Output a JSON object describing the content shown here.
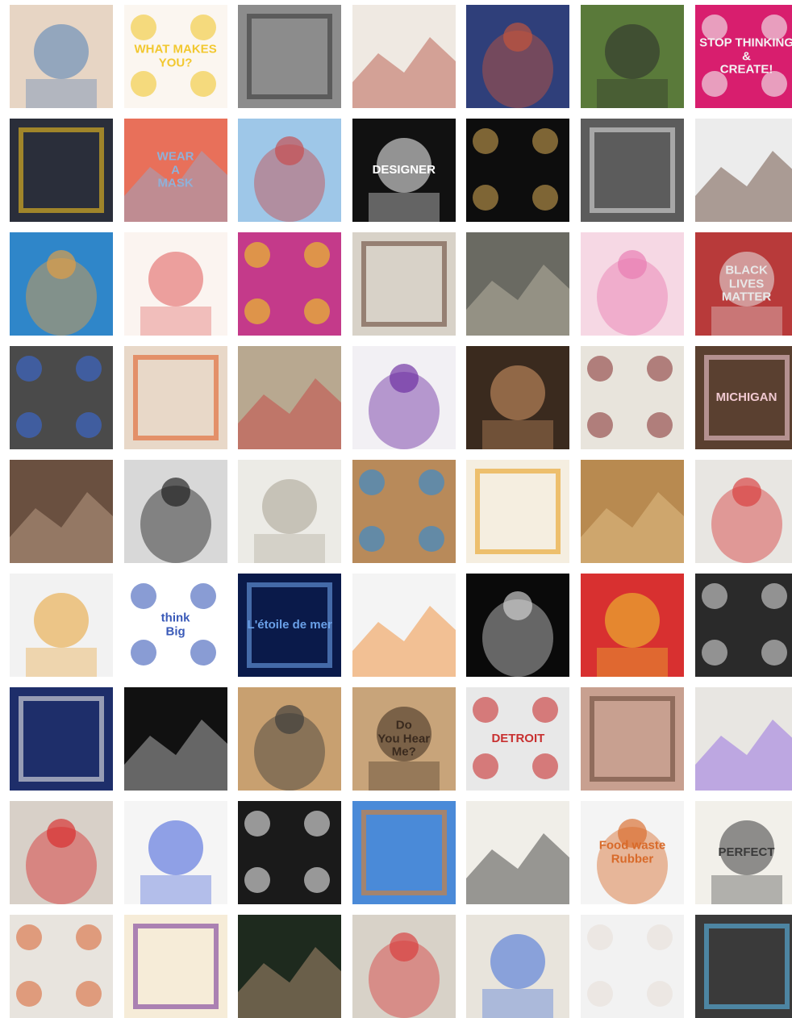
{
  "gallery": {
    "tiles": [
      {
        "name": "tile-portrait-blue-shirt",
        "bg": "#e7d5c4",
        "accent": "#4f7fb8",
        "text": ""
      },
      {
        "name": "tile-what-makes-you",
        "bg": "#fbf6f0",
        "accent": "#f2c830",
        "text": "WHAT MAKES\nYOU?"
      },
      {
        "name": "tile-elderly-woman-drawing",
        "bg": "#8c8c8c",
        "accent": "#3a3a3a",
        "text": ""
      },
      {
        "name": "tile-sketch-two-faces",
        "bg": "#efe9e2",
        "accent": "#b24a3a",
        "text": ""
      },
      {
        "name": "tile-painted-portrait-blue",
        "bg": "#2f3f7a",
        "accent": "#c9563a",
        "text": ""
      },
      {
        "name": "tile-woman-in-garden",
        "bg": "#5a7a3a",
        "accent": "#2b2b2b",
        "text": ""
      },
      {
        "name": "tile-stop-thinking-create",
        "bg": "#d81e6e",
        "accent": "#f3f3f3",
        "text": "STOP THINKING\n&\nCREATE!"
      },
      {
        "name": "tile-superman-portrait",
        "bg": "#2a2e3a",
        "accent": "#f0c020",
        "text": ""
      },
      {
        "name": "tile-wear-a-mask",
        "bg": "#e8705a",
        "accent": "#8fb0d8",
        "text": "WEAR\nA\nMASK"
      },
      {
        "name": "tile-jumping-figures",
        "bg": "#9ec7e8",
        "accent": "#c84a4a",
        "text": ""
      },
      {
        "name": "tile-designer-pattern",
        "bg": "#111111",
        "accent": "#ffffff",
        "text": "DESIGNER"
      },
      {
        "name": "tile-cone-and-bust",
        "bg": "#0d0d0d",
        "accent": "#c9a050",
        "text": ""
      },
      {
        "name": "tile-graphite-drawing",
        "bg": "#5c5c5c",
        "accent": "#d8d8d8",
        "text": ""
      },
      {
        "name": "tile-rock-sculpture",
        "bg": "#ececec",
        "accent": "#5a3a2a",
        "text": ""
      },
      {
        "name": "tile-swimming-pool",
        "bg": "#2f86c9",
        "accent": "#e8a040",
        "text": ""
      },
      {
        "name": "tile-red-dots",
        "bg": "#fbf4f0",
        "accent": "#e05a5a",
        "text": ""
      },
      {
        "name": "tile-colorful-costumes",
        "bg": "#c43a8a",
        "accent": "#f0d020",
        "text": ""
      },
      {
        "name": "tile-painted-man-portrait",
        "bg": "#d8d2c8",
        "accent": "#6a4a3a",
        "text": ""
      },
      {
        "name": "tile-studio-floor-work",
        "bg": "#6a6a62",
        "accent": "#c8c0b0",
        "text": ""
      },
      {
        "name": "tile-pink-shirts-illustration",
        "bg": "#f6d8e4",
        "accent": "#e87ab0",
        "text": ""
      },
      {
        "name": "tile-house-signs",
        "bg": "#b83a3a",
        "accent": "#e8e8e8",
        "text": "BLACK\nLIVES\nMATTER"
      },
      {
        "name": "tile-woman-lightning-shirt",
        "bg": "#4a4a4a",
        "accent": "#3a6ad8",
        "text": ""
      },
      {
        "name": "tile-colorful-studio",
        "bg": "#e8d8c8",
        "accent": "#e0602a",
        "text": ""
      },
      {
        "name": "tile-artist-at-table",
        "bg": "#b8a890",
        "accent": "#c83a3a",
        "text": ""
      },
      {
        "name": "tile-purple-suit",
        "bg": "#f2f0f4",
        "accent": "#6a2aa0",
        "text": ""
      },
      {
        "name": "tile-selfie-peace-sign",
        "bg": "#3a2a1e",
        "accent": "#d89a6a",
        "text": ""
      },
      {
        "name": "tile-studio-critique",
        "bg": "#e8e4dc",
        "accent": "#8a3a3a",
        "text": ""
      },
      {
        "name": "tile-michigan-shirt",
        "bg": "#5a4030",
        "accent": "#f0c8d0",
        "text": "MICHIGAN"
      },
      {
        "name": "tile-alley-buildings",
        "bg": "#6a5040",
        "accent": "#c8a890",
        "text": ""
      },
      {
        "name": "tile-ink-cityscape",
        "bg": "#d8d8d8",
        "accent": "#1a1a1a",
        "text": ""
      },
      {
        "name": "tile-printer-room",
        "bg": "#ecebe6",
        "accent": "#a8a090",
        "text": ""
      },
      {
        "name": "tile-painted-circles",
        "bg": "#b88a5a",
        "accent": "#2a8ad8",
        "text": ""
      },
      {
        "name": "tile-anime-illustration",
        "bg": "#f5eee0",
        "accent": "#e8a020",
        "text": ""
      },
      {
        "name": "tile-textured-surface",
        "bg": "#b88a50",
        "accent": "#e8c890",
        "text": ""
      },
      {
        "name": "tile-paper-pile",
        "bg": "#e8e6e2",
        "accent": "#d83a3a",
        "text": ""
      },
      {
        "name": "tile-hotdog-illustration",
        "bg": "#f2f2f2",
        "accent": "#e8a030",
        "text": ""
      },
      {
        "name": "tile-think-big",
        "bg": "#ffffff",
        "accent": "#3a5ab8",
        "text": "think\nBig"
      },
      {
        "name": "tile-stage-performance",
        "bg": "#0a1a4a",
        "accent": "#6aa0e8",
        "text": "L'étoile de mer"
      },
      {
        "name": "tile-orange-jacket",
        "bg": "#f4f4f4",
        "accent": "#f08020",
        "text": ""
      },
      {
        "name": "tile-cinema-screen",
        "bg": "#0a0a0a",
        "accent": "#d8d8d8",
        "text": ""
      },
      {
        "name": "tile-red-floral-collage",
        "bg": "#d83030",
        "accent": "#f0d030",
        "text": ""
      },
      {
        "name": "tile-bw-smiling-man",
        "bg": "#2a2a2a",
        "accent": "#d8d8d8",
        "text": ""
      },
      {
        "name": "tile-blue-textiles",
        "bg": "#1e2e6a",
        "accent": "#e8e8e8",
        "text": ""
      },
      {
        "name": "tile-film-strips",
        "bg": "#111111",
        "accent": "#cfcfcf",
        "text": ""
      },
      {
        "name": "tile-museum-gallery",
        "bg": "#c8a070",
        "accent": "#3a3a3a",
        "text": ""
      },
      {
        "name": "tile-do-you-hear-me",
        "bg": "#c8a47a",
        "accent": "#3a2a1e",
        "text": "Do\nYou Hear\nMe?"
      },
      {
        "name": "tile-detroit-guide",
        "bg": "#e8e8e8",
        "accent": "#c83030",
        "text": "DETROIT"
      },
      {
        "name": "tile-double-selfie",
        "bg": "#c8a090",
        "accent": "#6a4a3a",
        "text": ""
      },
      {
        "name": "tile-purple-sign",
        "bg": "#e8e6e2",
        "accent": "#8a5ae0",
        "text": ""
      },
      {
        "name": "tile-red-jacket",
        "bg": "#d8d0c8",
        "accent": "#d82a2a",
        "text": ""
      },
      {
        "name": "tile-candy-wrappers",
        "bg": "#f5f5f5",
        "accent": "#3a5ad8",
        "text": ""
      },
      {
        "name": "tile-white-octopus",
        "bg": "#1a1a1a",
        "accent": "#ececec",
        "text": ""
      },
      {
        "name": "tile-autumn-trees",
        "bg": "#4a8ad8",
        "accent": "#e0802a",
        "text": ""
      },
      {
        "name": "tile-botanical-sketches",
        "bg": "#f0eee8",
        "accent": "#2a2a2a",
        "text": ""
      },
      {
        "name": "tile-food-waste-rubber",
        "bg": "#f4f4f4",
        "accent": "#d86a2a",
        "text": "Food waste Rubber"
      },
      {
        "name": "tile-perfect-sketch",
        "bg": "#f2f0ea",
        "accent": "#3a3a3a",
        "text": "PERFECT"
      },
      {
        "name": "tile-collage-wall",
        "bg": "#e8e4de",
        "accent": "#d86a3a",
        "text": ""
      },
      {
        "name": "tile-purple-handwriting",
        "bg": "#f6ecd8",
        "accent": "#7a3a9a",
        "text": ""
      },
      {
        "name": "tile-man-in-shadow",
        "bg": "#1e2a1e",
        "accent": "#c8a080",
        "text": ""
      },
      {
        "name": "tile-gallery-performance",
        "bg": "#d8d2c8",
        "accent": "#d83a3a",
        "text": ""
      },
      {
        "name": "tile-framed-photo-woman",
        "bg": "#e8e4dc",
        "accent": "#3a6ad8",
        "text": ""
      },
      {
        "name": "tile-white-sculpture-hug",
        "bg": "#f2f2f2",
        "accent": "#e8e0d8",
        "text": ""
      },
      {
        "name": "tile-camera-screen",
        "bg": "#3a3a3a",
        "accent": "#5ab8e8",
        "text": ""
      }
    ]
  }
}
